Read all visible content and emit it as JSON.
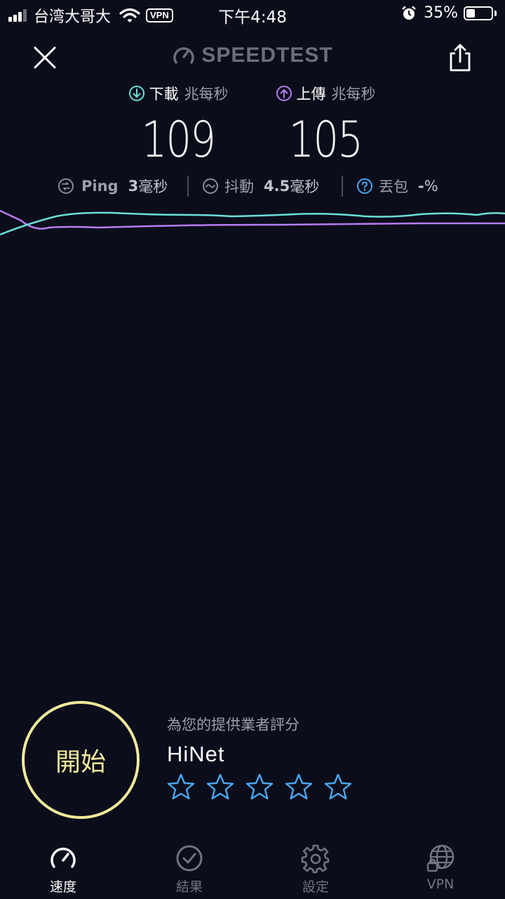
{
  "status_bar": {
    "carrier": "台湾大哥大",
    "vpn": "VPN",
    "time": "下午4:48",
    "battery_percent": "35%",
    "battery_level": 0.35
  },
  "header": {
    "logo_text": "SPEEDTEST"
  },
  "results": {
    "download": {
      "label": "下載",
      "unit": "兆每秒",
      "value": "109",
      "color": "#6ae0d8"
    },
    "upload": {
      "label": "上傳",
      "unit": "兆每秒",
      "value": "105",
      "color": "#b67cf0"
    }
  },
  "stats": {
    "ping": {
      "label": "Ping",
      "value": "3",
      "unit": "毫秒"
    },
    "jitter": {
      "label": "抖動",
      "value": "4.5",
      "unit": "毫秒"
    },
    "loss": {
      "label": "丟包",
      "value": "-",
      "unit": "%"
    }
  },
  "start": {
    "label": "開始",
    "color": "#f0ea9c"
  },
  "rating": {
    "prompt": "為您的提供業者評分",
    "provider": "HiNet",
    "stars_total": 5,
    "stars_filled": 0,
    "star_color": "#4aa8f0"
  },
  "nav": {
    "items": [
      {
        "label": "速度",
        "icon": "speedometer-icon",
        "active": true
      },
      {
        "label": "結果",
        "icon": "checkmark-circle-icon",
        "active": false
      },
      {
        "label": "設定",
        "icon": "gear-icon",
        "active": false
      },
      {
        "label": "VPN",
        "icon": "globe-lock-icon",
        "active": false
      }
    ]
  }
}
